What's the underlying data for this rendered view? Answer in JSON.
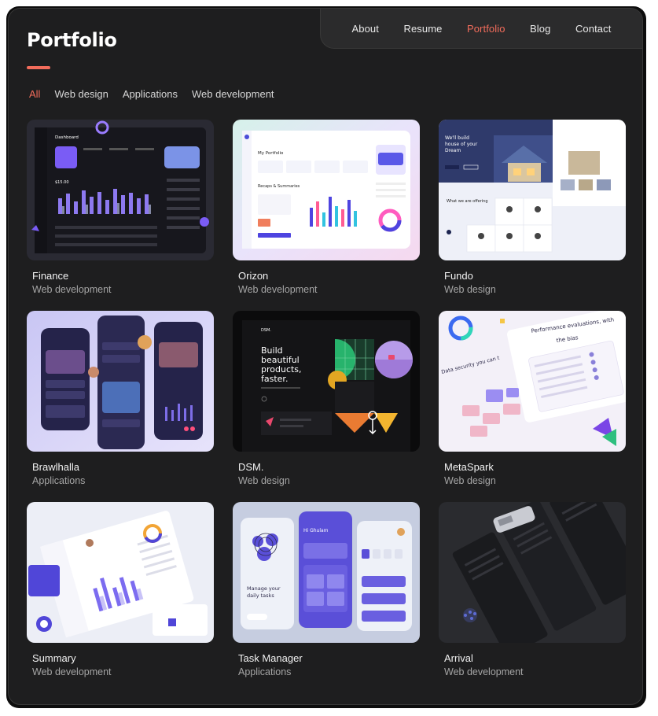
{
  "nav": [
    "About",
    "Resume",
    "Portfolio",
    "Blog",
    "Contact"
  ],
  "active_nav": "Portfolio",
  "page_title": "Portfolio",
  "filters": [
    "All",
    "Web design",
    "Applications",
    "Web development"
  ],
  "active_filter": "All",
  "accent_color": "#f26c5b",
  "projects": [
    {
      "title": "Finance",
      "category": "Web development"
    },
    {
      "title": "Orizon",
      "category": "Web development"
    },
    {
      "title": "Fundo",
      "category": "Web design"
    },
    {
      "title": "Brawlhalla",
      "category": "Applications"
    },
    {
      "title": "DSM.",
      "category": "Web design"
    },
    {
      "title": "MetaSpark",
      "category": "Web design"
    },
    {
      "title": "Summary",
      "category": "Web development"
    },
    {
      "title": "Task Manager",
      "category": "Applications"
    },
    {
      "title": "Arrival",
      "category": "Web development"
    }
  ],
  "thumbnails": {
    "finance": {
      "heading": "Dashboard",
      "balance": "$15.00"
    },
    "orizon": {
      "heading": "My Portfolio",
      "subheading": "Recaps & Summaries"
    },
    "fundo": {
      "heading": "We'll build house of your Dream",
      "subheading": "What we are offering"
    },
    "dsm": {
      "heading": "Build beautiful products, faster."
    },
    "metaspark": {
      "heading": "Performance evaluations, with the bias",
      "subheading": "Data security you can t"
    },
    "task": {
      "heading": "Manage your daily tasks",
      "greeting": "Hi Ghulam"
    }
  }
}
